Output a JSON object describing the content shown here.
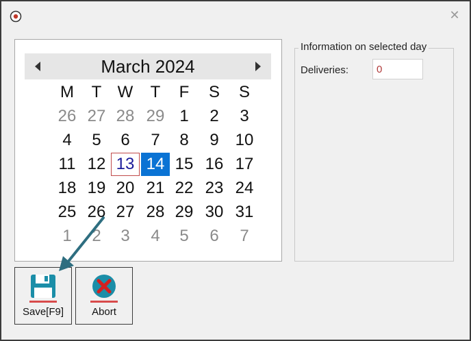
{
  "window": {
    "close_glyph": "✕"
  },
  "calendar": {
    "title": "March 2024",
    "weekdays": [
      "M",
      "T",
      "W",
      "T",
      "F",
      "S",
      "S"
    ],
    "weeks": [
      [
        {
          "d": "26",
          "other": true
        },
        {
          "d": "27",
          "other": true
        },
        {
          "d": "28",
          "other": true
        },
        {
          "d": "29",
          "other": true
        },
        {
          "d": "1"
        },
        {
          "d": "2"
        },
        {
          "d": "3"
        }
      ],
      [
        {
          "d": "4"
        },
        {
          "d": "5"
        },
        {
          "d": "6"
        },
        {
          "d": "7"
        },
        {
          "d": "8"
        },
        {
          "d": "9"
        },
        {
          "d": "10"
        }
      ],
      [
        {
          "d": "11"
        },
        {
          "d": "12"
        },
        {
          "d": "13",
          "today": true
        },
        {
          "d": "14",
          "selected": true
        },
        {
          "d": "15"
        },
        {
          "d": "16"
        },
        {
          "d": "17"
        }
      ],
      [
        {
          "d": "18"
        },
        {
          "d": "19"
        },
        {
          "d": "20"
        },
        {
          "d": "21"
        },
        {
          "d": "22"
        },
        {
          "d": "23"
        },
        {
          "d": "24"
        }
      ],
      [
        {
          "d": "25"
        },
        {
          "d": "26"
        },
        {
          "d": "27"
        },
        {
          "d": "28"
        },
        {
          "d": "29"
        },
        {
          "d": "30"
        },
        {
          "d": "31"
        }
      ],
      [
        {
          "d": "1",
          "other": true
        },
        {
          "d": "2",
          "other": true
        },
        {
          "d": "3",
          "other": true
        },
        {
          "d": "4",
          "other": true
        },
        {
          "d": "5",
          "other": true
        },
        {
          "d": "6",
          "other": true
        },
        {
          "d": "7",
          "other": true
        }
      ]
    ],
    "prev_icon": "chevron-left-icon",
    "next_icon": "chevron-right-icon"
  },
  "info": {
    "legend": "Information on selected day",
    "deliveries_label": "Deliveries:",
    "deliveries_value": "0"
  },
  "toolbar": {
    "save_label": "Save[F9]",
    "abort_label": "Abort",
    "save_icon": "floppy-disk-icon",
    "abort_icon": "x-circle-icon"
  },
  "colors": {
    "selected_day": "#0a73d4",
    "today_outline": "#c14a4a",
    "annotation_arrow": "#2e6e80",
    "save_icon": "#1b8ea8",
    "abort_icon": "#d42020"
  }
}
